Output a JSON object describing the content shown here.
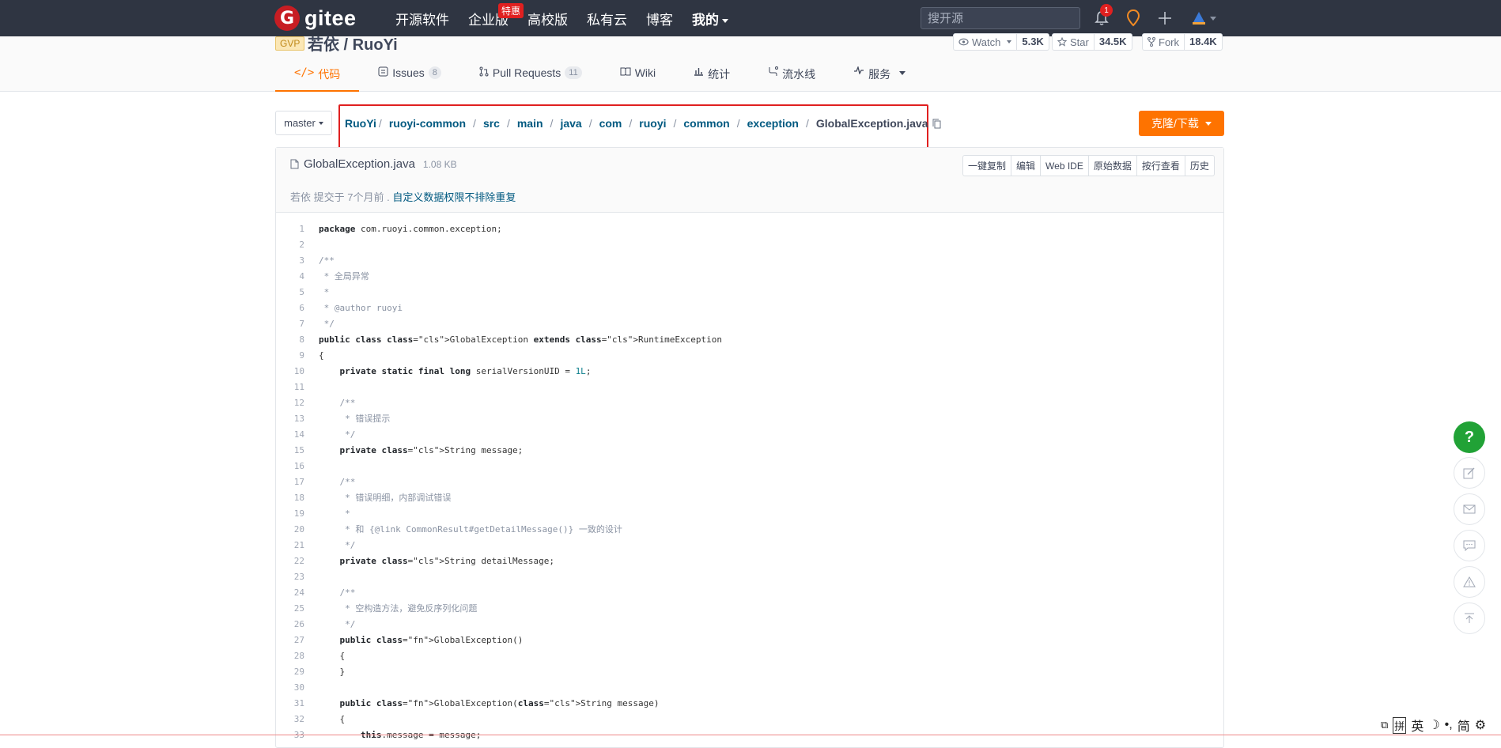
{
  "nav": {
    "logo": "gitee",
    "items": [
      "开源软件",
      "企业版",
      "高校版",
      "私有云",
      "博客",
      "我的"
    ],
    "enterprise_badge": "特惠",
    "search_placeholder": "搜开源",
    "notif_count": "1"
  },
  "repo": {
    "gvp": "GVP",
    "name": "若依 / RuoYi",
    "watch_label": "Watch",
    "watch_count": "5.3K",
    "star_label": "Star",
    "star_count": "34.5K",
    "fork_label": "Fork",
    "fork_count": "18.4K"
  },
  "tabs": {
    "code": "代码",
    "issues": "Issues",
    "issues_count": "8",
    "pulls": "Pull Requests",
    "pulls_count": "11",
    "wiki": "Wiki",
    "stats": "统计",
    "pipeline": "流水线",
    "services": "服务"
  },
  "branch": "master",
  "breadcrumb": [
    "RuoYi",
    "ruoyi-common",
    "src",
    "main",
    "java",
    "com",
    "ruoyi",
    "common",
    "exception",
    "GlobalException.java"
  ],
  "clone_label": "克隆/下载",
  "file": {
    "name": "GlobalException.java",
    "size": "1.08 KB",
    "actions": [
      "一键复制",
      "编辑",
      "Web IDE",
      "原始数据",
      "按行查看",
      "历史"
    ],
    "commit_author": "若依",
    "commit_text": "提交于",
    "commit_time": "7个月前 .",
    "commit_msg": "自定义数据权限不排除重复"
  },
  "code": [
    "1",
    "package com.ruoyi.common.exception;",
    "2",
    "",
    "3",
    "/**",
    "4",
    " * 全局异常",
    "5",
    " *",
    "6",
    " * @author ruoyi",
    "7",
    " */",
    "8",
    "public class GlobalException extends RuntimeException",
    "9",
    "{",
    "10",
    "    private static final long serialVersionUID = 1L;",
    "11",
    "",
    "12",
    "    /**",
    "13",
    "     * 错误提示",
    "14",
    "     */",
    "15",
    "    private String message;",
    "16",
    "",
    "17",
    "    /**",
    "18",
    "     * 错误明细，内部调试错误",
    "19",
    "     *",
    "20",
    "     * 和 {@link CommonResult#getDetailMessage()} 一致的设计",
    "21",
    "     */",
    "22",
    "    private String detailMessage;",
    "23",
    "",
    "24",
    "    /**",
    "25",
    "     * 空构造方法，避免反序列化问题",
    "26",
    "     */",
    "27",
    "    public GlobalException()",
    "28",
    "    {",
    "29",
    "    }",
    "30",
    "",
    "31",
    "    public GlobalException(String message)",
    "32",
    "    {",
    "33",
    "        this.message = message;"
  ],
  "float": {
    "help": "?"
  },
  "ime": [
    "拼",
    "英",
    "简"
  ]
}
